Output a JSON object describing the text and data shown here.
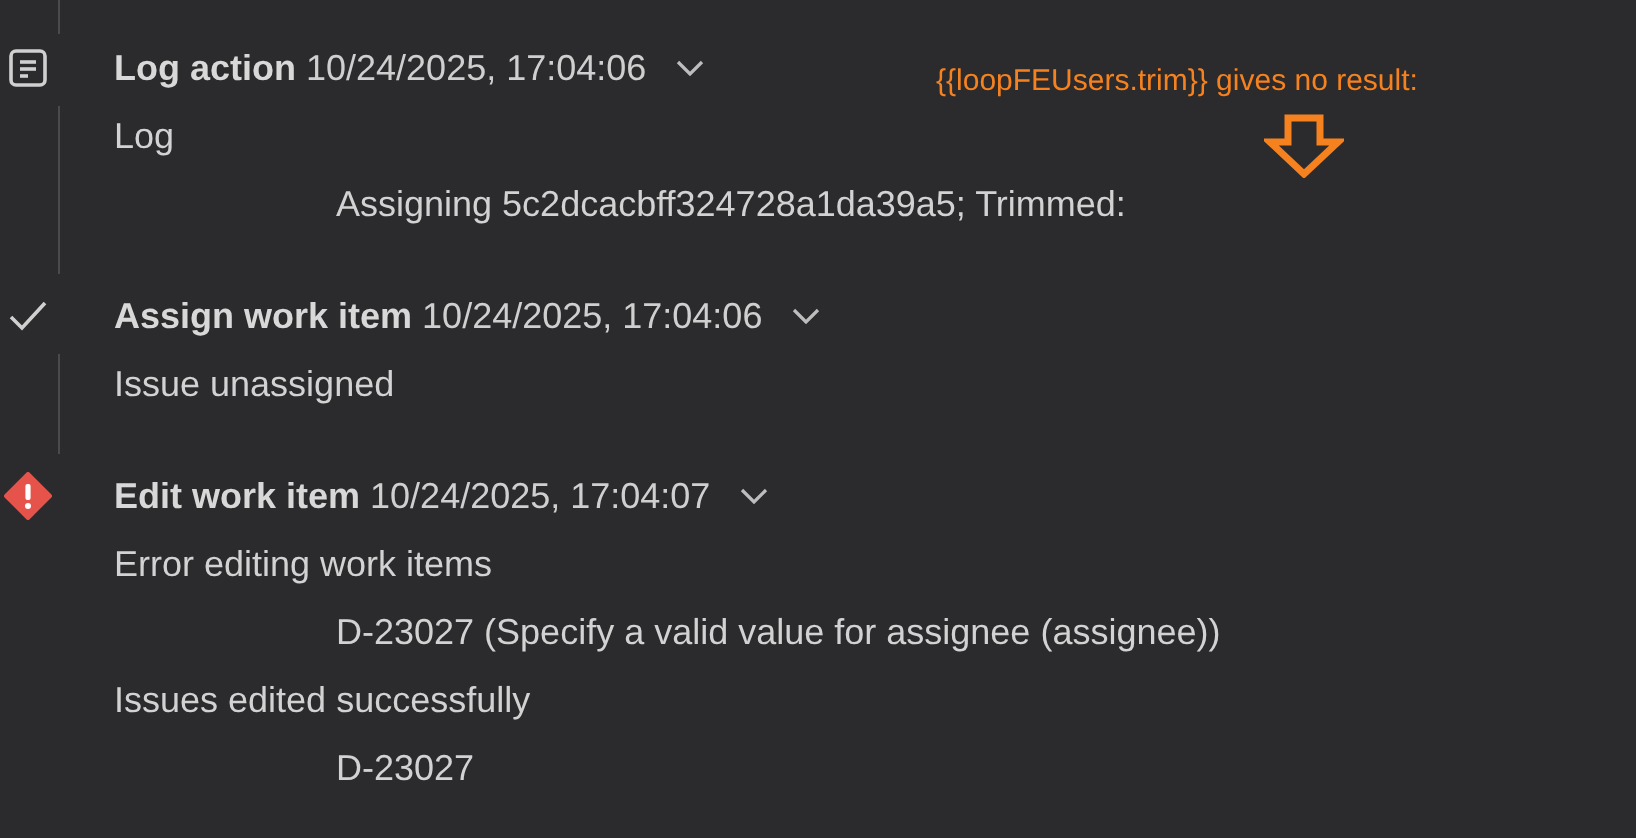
{
  "events": [
    {
      "kind": "log",
      "title": "Log action",
      "time": "10/24/2025, 17:04:06",
      "lines": [
        {
          "text": "Log",
          "indented": false
        },
        {
          "text": "Assigning 5c2dcacbff324728a1da39a5; Trimmed:",
          "indented": true
        }
      ]
    },
    {
      "kind": "success",
      "title": "Assign work item",
      "time": "10/24/2025, 17:04:06",
      "lines": [
        {
          "text": "Issue unassigned",
          "indented": false
        }
      ]
    },
    {
      "kind": "error",
      "title": "Edit work item",
      "time": "10/24/2025, 17:04:07",
      "lines": [
        {
          "text": "Error editing work items",
          "indented": false
        },
        {
          "text": "D-23027 (Specify a valid value for assignee (assignee))",
          "indented": true
        },
        {
          "text": "Issues edited successfully",
          "indented": false
        },
        {
          "text": "D-23027",
          "indented": true
        }
      ]
    }
  ],
  "annotation": {
    "text": "{{loopFEUsers.trim}} gives no result:"
  }
}
